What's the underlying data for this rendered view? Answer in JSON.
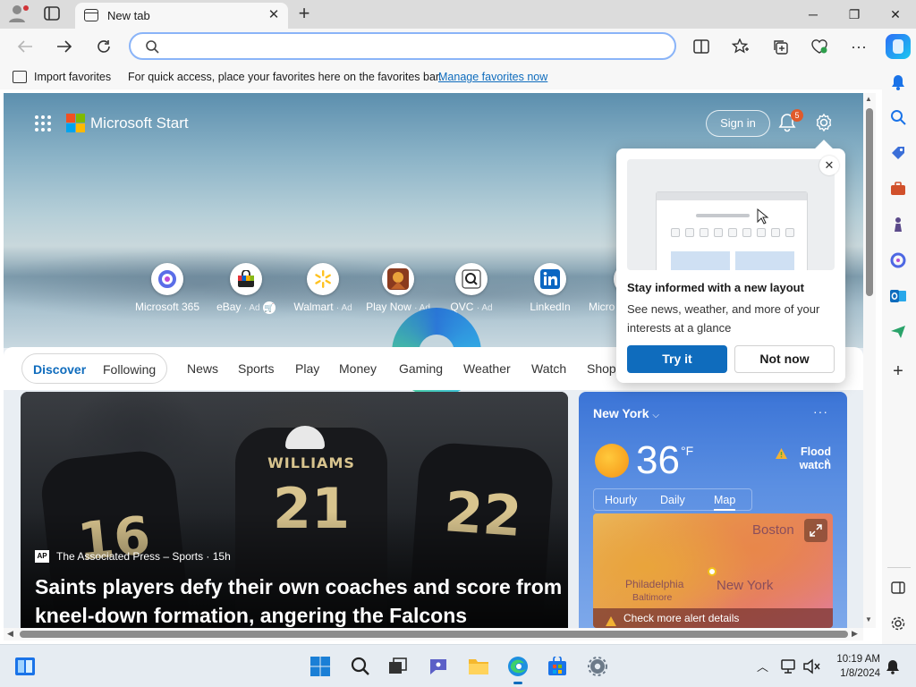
{
  "browser": {
    "tab": {
      "title": "New tab"
    },
    "address": {
      "value": "",
      "placeholder": ""
    },
    "favorites_bar": {
      "import_label": "Import favorites",
      "hint": "For quick access, place your favorites here on the favorites bar.",
      "manage_link": "Manage favorites now"
    }
  },
  "start": {
    "brand": "Microsoft Start",
    "sign_in": "Sign in",
    "notification_count": "5",
    "quick_links": [
      {
        "label": "Microsoft 365",
        "ad": ""
      },
      {
        "label": "eBay",
        "ad": "· Ad"
      },
      {
        "label": "Walmart",
        "ad": "· Ad"
      },
      {
        "label": "Play Now",
        "ad": "· Ad"
      },
      {
        "label": "QVC",
        "ad": "· Ad"
      },
      {
        "label": "LinkedIn",
        "ad": ""
      },
      {
        "label": "Micro",
        "ad": ""
      }
    ],
    "feed_pills": [
      "Discover",
      "Following"
    ],
    "nav": [
      "News",
      "Sports",
      "Play",
      "Money",
      "Gaming",
      "Weather",
      "Watch",
      "Shop"
    ]
  },
  "main_story": {
    "source": "The Associated Press – Sports · 15h",
    "source_logo": "AP",
    "headline": "Saints players defy their own coaches and score from kneel-down formation, angering the Falcons",
    "jersey_name": "WILLIAMS",
    "jersey_numbers": [
      "16",
      "21",
      "22"
    ]
  },
  "weather": {
    "location": "New York",
    "temperature": "36",
    "unit": "°F",
    "alert": "Flood watch",
    "tabs": [
      "Hourly",
      "Daily",
      "Map"
    ],
    "selected_tab": "Map",
    "map_labels": [
      "Boston",
      "Philadelphia",
      "Baltimore",
      "New York"
    ],
    "alert_link": "Check more alert details"
  },
  "popup": {
    "title": "Stay informed with a new layout",
    "description": "See news, weather, and more of your interests at a glance",
    "primary": "Try it",
    "secondary": "Not now"
  },
  "taskbar": {
    "time": "10:19 AM",
    "date": "1/8/2024"
  },
  "colors": {
    "accent": "#0f6cbd",
    "address_focus": "#8ab4f8",
    "badge": "#e05a2b"
  }
}
